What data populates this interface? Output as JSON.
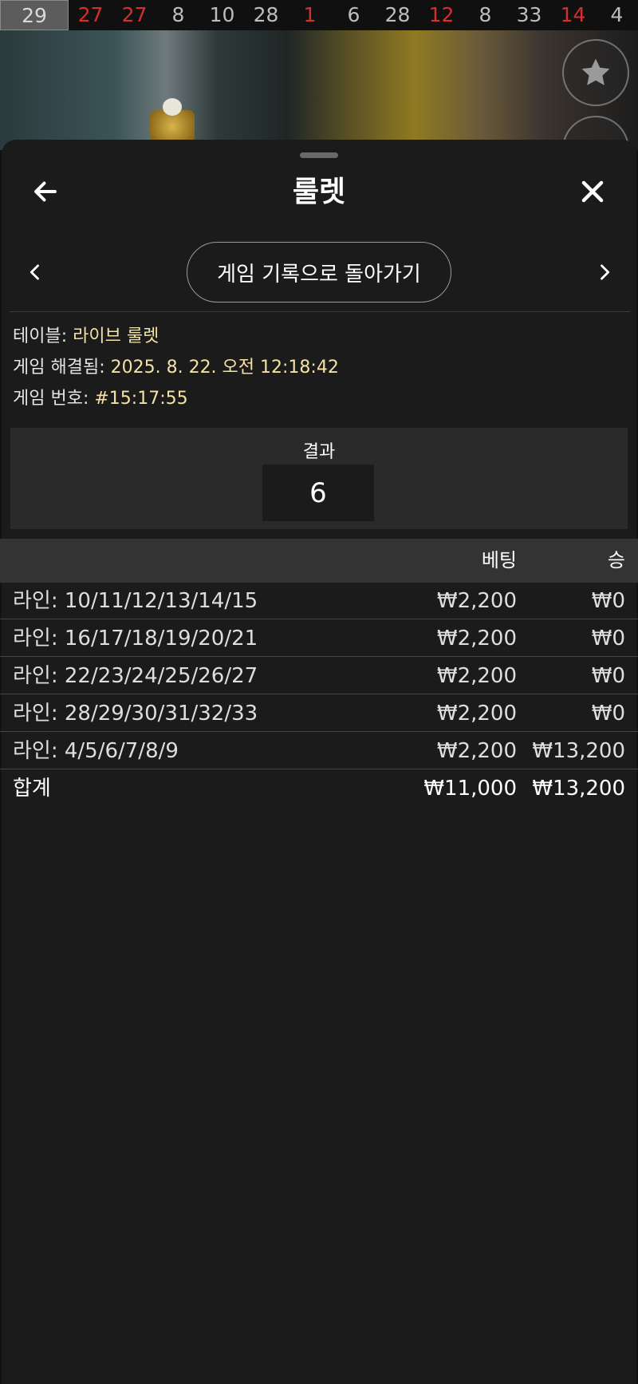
{
  "strip": {
    "numbers": [
      {
        "value": "29",
        "color": "gray",
        "current": true
      },
      {
        "value": "27",
        "color": "red"
      },
      {
        "value": "27",
        "color": "red"
      },
      {
        "value": "8",
        "color": "gray"
      },
      {
        "value": "10",
        "color": "gray"
      },
      {
        "value": "28",
        "color": "gray"
      },
      {
        "value": "1",
        "color": "red"
      },
      {
        "value": "6",
        "color": "gray"
      },
      {
        "value": "28",
        "color": "gray"
      },
      {
        "value": "12",
        "color": "red"
      },
      {
        "value": "8",
        "color": "gray"
      },
      {
        "value": "33",
        "color": "gray"
      },
      {
        "value": "14",
        "color": "red"
      },
      {
        "value": "4",
        "color": "gray"
      }
    ]
  },
  "side_buttons": {
    "favorite_icon": "star-icon"
  },
  "header": {
    "title": "룰렛",
    "back_icon": "arrow-left-icon",
    "close_icon": "close-icon"
  },
  "nav": {
    "prev_icon": "chevron-left-icon",
    "next_icon": "chevron-right-icon",
    "back_to_history": "게임 기록으로 돌아가기"
  },
  "info": {
    "table_label": "테이블: ",
    "table_value": "라이브 룰렛",
    "resolved_label": "게임 해결됨: ",
    "resolved_value": "2025. 8. 22. 오전 12:18:42",
    "game_no_label": "게임 번호: ",
    "game_no_value": "#15:17:55"
  },
  "result": {
    "label": "결과",
    "value": "6"
  },
  "bets_table": {
    "headers": {
      "bet": "베팅",
      "win": "승"
    },
    "rows": [
      {
        "line": "라인: 10/11/12/13/14/15",
        "bet": "₩2,200",
        "win": "₩0"
      },
      {
        "line": "라인: 16/17/18/19/20/21",
        "bet": "₩2,200",
        "win": "₩0"
      },
      {
        "line": "라인: 22/23/24/25/26/27",
        "bet": "₩2,200",
        "win": "₩0"
      },
      {
        "line": "라인: 28/29/30/31/32/33",
        "bet": "₩2,200",
        "win": "₩0"
      },
      {
        "line": "라인: 4/5/6/7/8/9",
        "bet": "₩2,200",
        "win": "₩13,200"
      }
    ],
    "total": {
      "label": "합계",
      "bet": "₩11,000",
      "win": "₩13,200"
    }
  },
  "colors": {
    "red": "#d32f2f",
    "gray": "#bdbdbd",
    "accent_value": "#f3e2a4",
    "panel_bg": "#1b1b1b"
  }
}
